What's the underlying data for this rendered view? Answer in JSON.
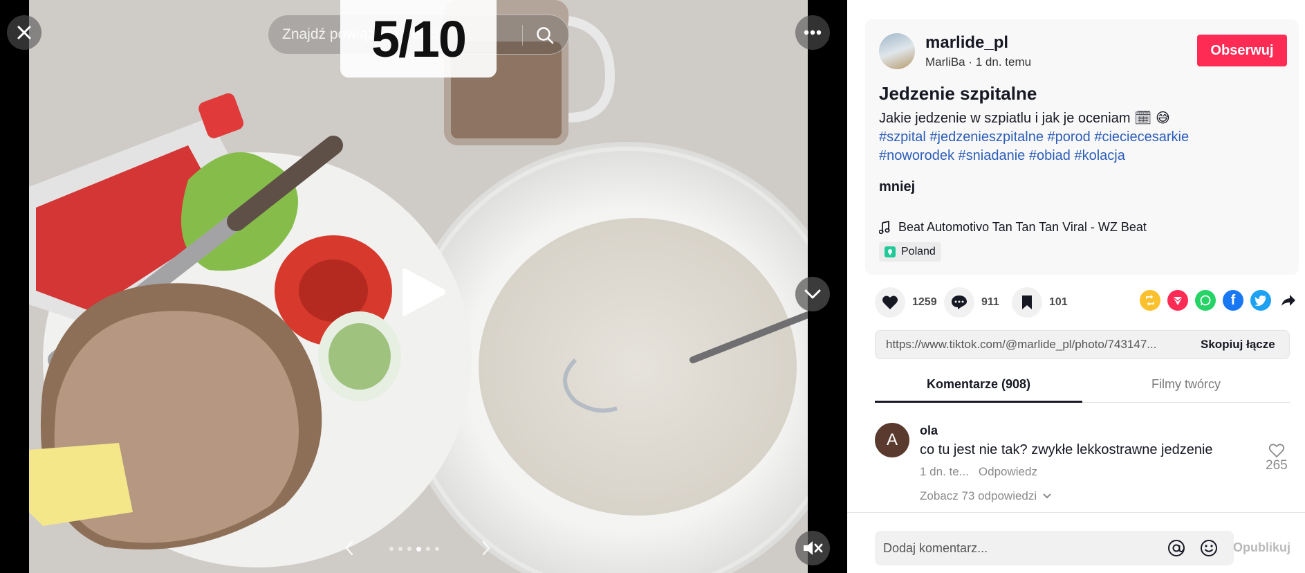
{
  "viewer": {
    "search_placeholder": "Znajdź powiązane treści",
    "counter": "5/10",
    "dots_total": 6,
    "dots_active_index": 3
  },
  "author": {
    "username": "marlide_pl",
    "display_line": "MarliBa · 1 dn. temu",
    "follow_label": "Obserwuj"
  },
  "post": {
    "title": "Jedzenie szpitalne",
    "description": "Jakie jedzenie w szpiatlu i jak je oceniam",
    "hashtags": [
      "#szpital",
      "#jedzenieszpitalne",
      "#porod",
      "#ciecieсesarkie",
      "#noworodek",
      "#sniadanie",
      "#obiad",
      "#kolacja"
    ],
    "less_label": "mniej",
    "music": "Beat Automotivo Tan Tan Tan Viral - WZ Beat",
    "location": "Poland"
  },
  "actions": {
    "likes": "1259",
    "comments": "911",
    "saves": "101"
  },
  "share": {
    "url": "https://www.tiktok.com/@marlide_pl/photo/743147...",
    "copy_label": "Skopiuj łącze"
  },
  "tabs": [
    {
      "label": "Komentarze (908)",
      "active": true
    },
    {
      "label": "Filmy twórcy",
      "active": false
    }
  ],
  "comment": {
    "avatar_letter": "A",
    "user": "ola",
    "text": "co tu jest nie tak? zwykłe lekkostrawne jedzenie",
    "time": "1 dn. te...",
    "reply_label": "Odpowiedz",
    "likes": "265",
    "view_replies": "Zobacz 73 odpowiedzi"
  },
  "composer": {
    "placeholder": "Dodaj komentarz...",
    "publish_label": "Opublikuj"
  },
  "colors": {
    "accent": "#fe2c55",
    "hashtag": "#2b5db9"
  }
}
